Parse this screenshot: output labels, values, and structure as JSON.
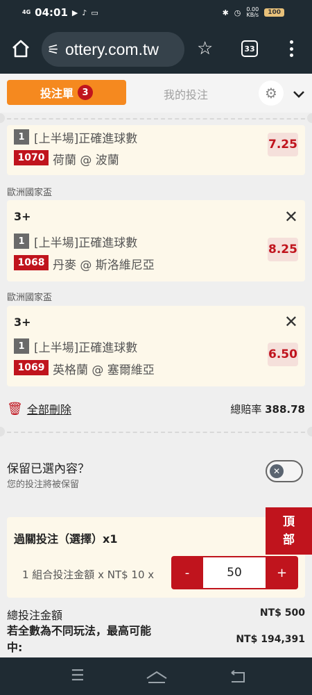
{
  "status_bar": {
    "network": "4G",
    "time": "04:01",
    "speed": "0.00",
    "speed_unit": "KB/s",
    "battery": "100"
  },
  "browser": {
    "url": "ottery.com.tw",
    "tab_count": "33"
  },
  "slip": {
    "tab_betslip": "投注單",
    "tab_betslip_count": "3",
    "tab_mybets": "我的投注"
  },
  "bets": [
    {
      "market_num": "1",
      "market": "[上半場]正確進球數",
      "code": "1070",
      "match": "荷蘭 @ 波蘭",
      "odds": "7.25"
    },
    {
      "league": "歐洲國家盃",
      "selection": "3+",
      "market_num": "1",
      "market": "[上半場]正確進球數",
      "code": "1068",
      "match": "丹麥 @ 斯洛維尼亞",
      "odds": "8.25"
    },
    {
      "league": "歐洲國家盃",
      "selection": "3+",
      "market_num": "1",
      "market": "[上半場]正確進球數",
      "code": "1069",
      "match": "英格蘭 @ 塞爾維亞",
      "odds": "6.50"
    }
  ],
  "summary": {
    "delete_all": "全部刪除",
    "total_odds_label": "總賠率",
    "total_odds_value": "388.78"
  },
  "keep": {
    "title": "保留已選內容？",
    "subtitle": "您的投注將被保留"
  },
  "parlay": {
    "title": "過關投注（選擇）x1",
    "combo_label": "1 組合投注金額 x NT$ 10 x",
    "minus": "-",
    "amount": "50",
    "plus": "+"
  },
  "top_button": "頂部",
  "totals": {
    "stake_label": "總投注金額",
    "stake_value": "NT$ 500",
    "max_win_label": "若全數為不同玩法，最高可能中:",
    "max_win_value": "NT$ 194,391"
  },
  "colors": {
    "accent": "#f5891f",
    "brand_red": "#c0141d",
    "card_bg": "#fdf8ea",
    "chrome_bg": "#1f2b33"
  },
  "icons": [
    "home-icon",
    "tune-icon",
    "star-icon",
    "tabs-icon",
    "more-icon",
    "gear-icon",
    "chevron-down-icon",
    "close-icon",
    "trash-icon",
    "menu-icon",
    "home-nav-icon",
    "back-icon"
  ]
}
